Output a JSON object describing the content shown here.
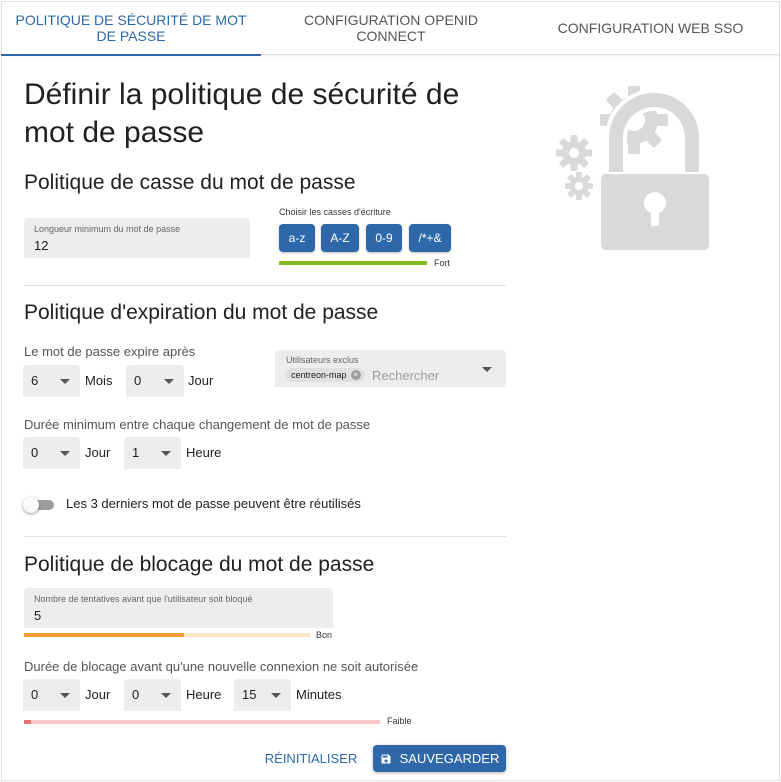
{
  "tabs": [
    {
      "label": "POLITIQUE DE SÉCURITÉ DE MOT DE PASSE"
    },
    {
      "label": "CONFIGURATION OPENID CONNECT"
    },
    {
      "label": "CONFIGURATION WEB SSO"
    }
  ],
  "active_tab": 0,
  "page_title": "Définir la politique de sécurité de mot de passe",
  "case_policy": {
    "title": "Politique de casse du mot de passe",
    "min_length": {
      "label": "Longueur minimum du mot de passe",
      "value": "12"
    },
    "cases_label": "Choisir les casses d'écriture",
    "case_buttons": [
      "a-z",
      "A-Z",
      "0-9",
      "/*+&"
    ],
    "strength": {
      "label": "Fort",
      "fraction": 1.0,
      "color": "#88b922"
    }
  },
  "expiration_policy": {
    "title": "Politique d'expiration du mot de passe",
    "expires_after_label": "Le mot de passe expire après",
    "months_value": "6",
    "months_unit": "Mois",
    "days_value": "0",
    "days_unit": "Jour",
    "excluded_users": {
      "label": "Utilisateurs exclus",
      "chips": [
        "centreon-map"
      ],
      "placeholder": "Rechercher"
    },
    "min_change_label": "Durée minimum entre chaque changement de mot de passe",
    "min_change_days_value": "0",
    "min_change_days_unit": "Jour",
    "min_change_hours_value": "1",
    "min_change_hours_unit": "Heure",
    "reuse_toggle_label": "Les 3 derniers mot de passe peuvent être réutilisés",
    "reuse_toggle_on": false
  },
  "blocking_policy": {
    "title": "Politique de blocage du mot de passe",
    "attempts": {
      "label": "Nombre de tentatives avant que l'utilisateur soit bloqué",
      "value": "5"
    },
    "attempts_strength": {
      "label": "Bon",
      "fraction": 0.56,
      "color": "#f29d2f",
      "track_color": "#fde3c4"
    },
    "block_duration_label": "Durée de blocage avant qu'une nouvelle connexion ne soit autorisée",
    "days_value": "0",
    "days_unit": "Jour",
    "hours_value": "0",
    "hours_unit": "Heure",
    "minutes_value": "15",
    "minutes_unit": "Minutes",
    "duration_strength": {
      "label": "Faible",
      "fraction": 0.02,
      "color": "#e57373",
      "track_color": "#f7c6c6"
    }
  },
  "actions": {
    "reset_label": "RÉINITIALISER",
    "save_label": "SAUVEGARDER"
  },
  "icons": [
    "save-icon",
    "clear-icon",
    "arrow-drop-down-icon",
    "lock-gears-illustration"
  ],
  "colors": {
    "primary": "#2e68aa",
    "illustration": "#d9d9d9"
  }
}
